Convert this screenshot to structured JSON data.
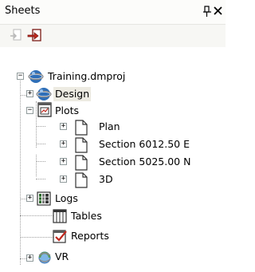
{
  "panel": {
    "title": "Sheets",
    "pin_glyph": "ᵽ",
    "close_glyph": "✕"
  },
  "toolbar": {
    "buttons": [
      {
        "icon": "import-sheet-icon",
        "state": "disabled"
      },
      {
        "icon": "export-sheet-icon",
        "state": "enabled",
        "color": "#c0281e"
      }
    ]
  },
  "tree": {
    "root": {
      "label": "Training.dmproj",
      "expanded": true
    },
    "items": [
      {
        "label": "Design",
        "icon": "globe-icon",
        "expander": "+",
        "selected": true
      },
      {
        "label": "Plots",
        "icon": "plot-sheet-icon",
        "expander": "-",
        "children": [
          {
            "label": "Plan",
            "icon": "page-icon",
            "expander": "+"
          },
          {
            "label": "Section 6012.50 E",
            "icon": "page-icon",
            "expander": "+"
          },
          {
            "label": "Section 5025.00 N",
            "icon": "page-icon",
            "expander": "+"
          },
          {
            "label": "3D",
            "icon": "page-icon",
            "expander": "+"
          }
        ]
      },
      {
        "label": "Logs",
        "icon": "logs-icon",
        "expander": "+"
      },
      {
        "label": "Tables",
        "icon": "tables-icon",
        "expander": ""
      },
      {
        "label": "Reports",
        "icon": "reports-icon",
        "expander": ""
      },
      {
        "label": "VR",
        "icon": "vr-icon",
        "expander": "+"
      }
    ]
  },
  "colors": {
    "selection": "#edebe2",
    "expander_border": "#919b9c",
    "tree_lines": "#a0a0a0",
    "globe_blue": "#2f6fb8"
  }
}
